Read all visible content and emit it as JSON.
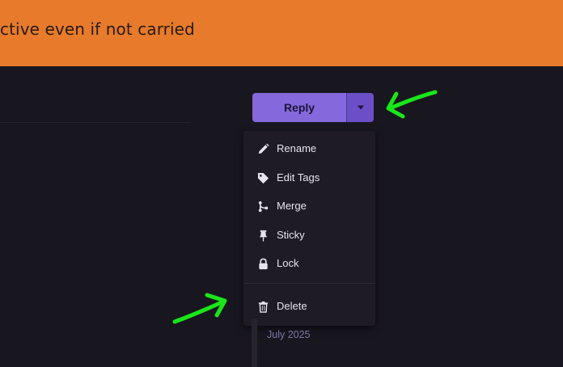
{
  "banner": {
    "text": "ctive even if not carried",
    "color": "#e77b2b"
  },
  "reply": {
    "label": "Reply",
    "accent": "#8468dc"
  },
  "menu": {
    "items": [
      {
        "label": "Rename",
        "icon": "pencil-icon"
      },
      {
        "label": "Edit Tags",
        "icon": "tag-icon"
      },
      {
        "label": "Merge",
        "icon": "merge-icon"
      },
      {
        "label": "Sticky",
        "icon": "pin-icon"
      },
      {
        "label": "Lock",
        "icon": "lock-icon"
      },
      {
        "label": "Delete",
        "icon": "trash-icon"
      }
    ]
  },
  "timeline": {
    "date": "July 2025"
  },
  "annotations": {
    "arrow_color": "#19e619"
  }
}
